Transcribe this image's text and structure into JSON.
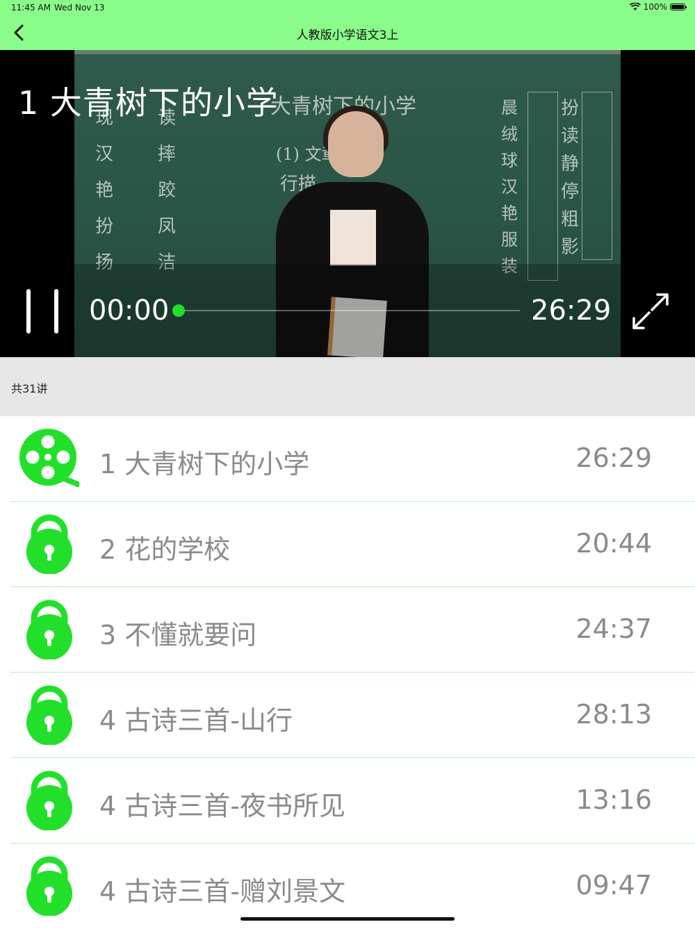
{
  "status_bar": {
    "time": "11:45 AM",
    "date": "Wed Nov 13",
    "battery": "100%"
  },
  "nav": {
    "title": "人教版小学语文3上",
    "back_icon": "chevron-left-icon"
  },
  "player": {
    "video_title": "1 大青树下的小学",
    "current_time": "00:00",
    "total_time": "26:29",
    "progress": 0,
    "accent_color": "#22e02a",
    "board_chars_left": [
      "现",
      "读",
      "汉",
      "摔",
      "艳",
      "跤",
      "扮",
      "凤",
      "扬",
      "洁"
    ],
    "board_heading": "大青树下的小学",
    "board_line1": "(1) 文章",
    "board_line1b": "行描",
    "board_right1": [
      "晨",
      "绒",
      "球",
      "汉",
      "艳",
      "服",
      "装"
    ],
    "board_right2": [
      "扮",
      "读",
      "静",
      "停",
      "粗",
      "影"
    ]
  },
  "section": {
    "label": "共31讲"
  },
  "lessons": [
    {
      "title": "1 大青树下的小学",
      "duration": "26:29",
      "icon": "film-reel-icon",
      "locked": false
    },
    {
      "title": "2 花的学校",
      "duration": "20:44",
      "icon": "lock-icon",
      "locked": true
    },
    {
      "title": "3 不懂就要问",
      "duration": "24:37",
      "icon": "lock-icon",
      "locked": true
    },
    {
      "title": "4 古诗三首-山行",
      "duration": "28:13",
      "icon": "lock-icon",
      "locked": true
    },
    {
      "title": "4 古诗三首-夜书所见",
      "duration": "13:16",
      "icon": "lock-icon",
      "locked": true
    },
    {
      "title": "4 古诗三首-赠刘景文",
      "duration": "09:47",
      "icon": "lock-icon",
      "locked": true
    }
  ],
  "colors": {
    "nav_green": "#8afc8a",
    "icon_green": "#22e02a",
    "text_gray": "#8a8a8a"
  }
}
